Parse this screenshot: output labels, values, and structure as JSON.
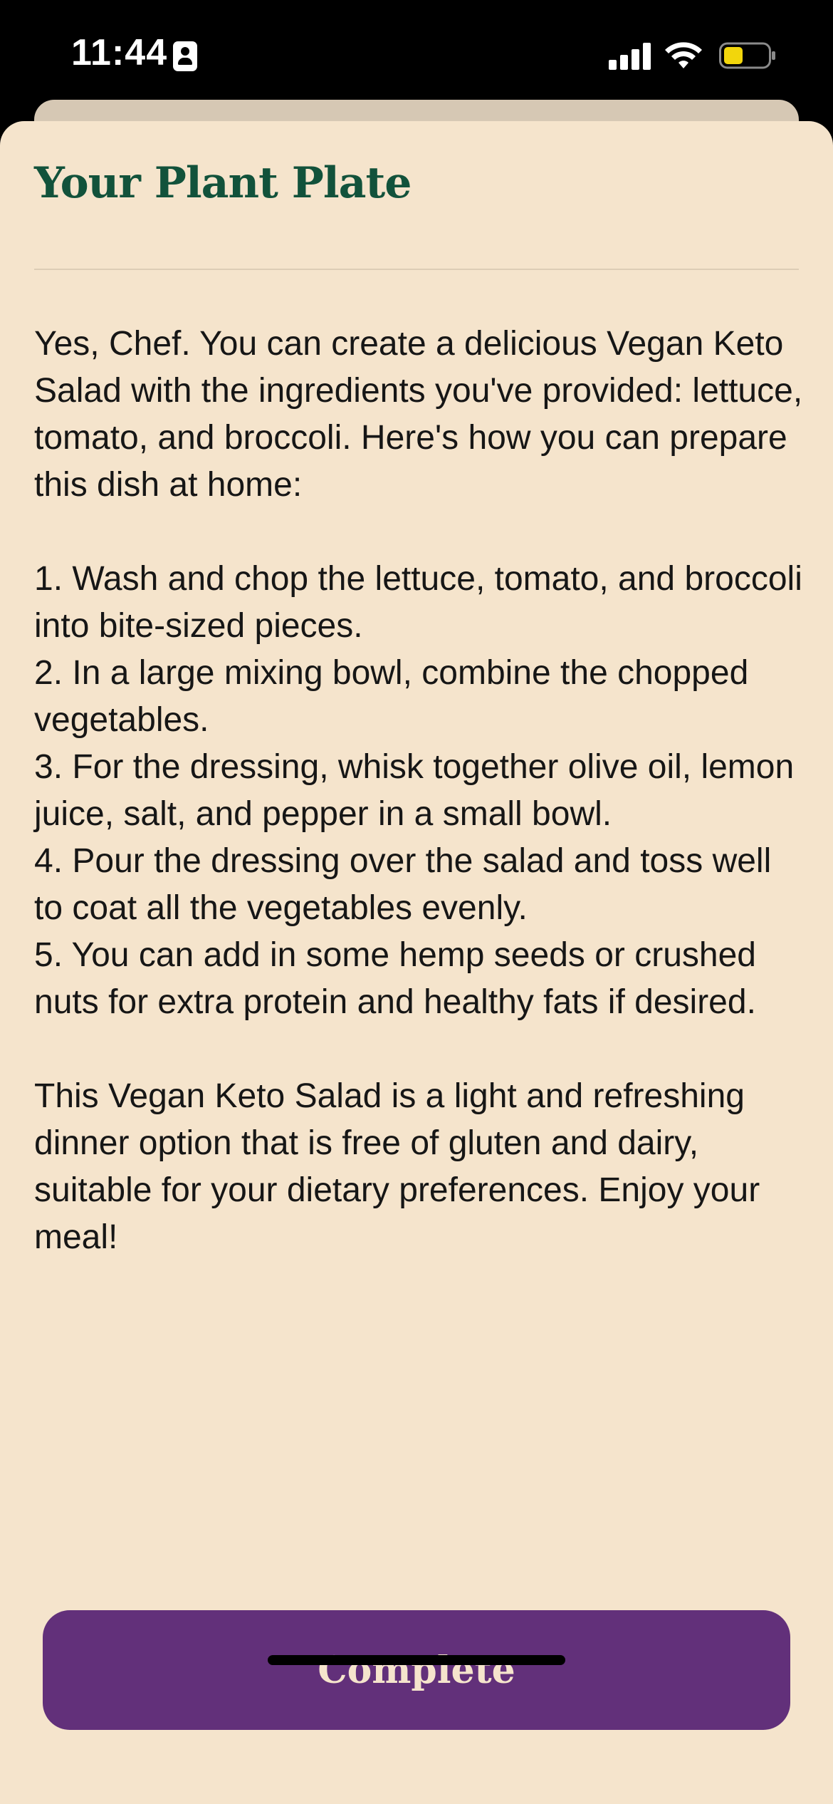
{
  "status_bar": {
    "time": "11:44",
    "battery_color": "#f2d60c"
  },
  "sheet": {
    "title": "Your Plant Plate",
    "paragraphs": [
      "Yes, Chef. You can create a delicious Vegan Keto Salad with the ingredients you've provided: lettuce, tomato, and broccoli. Here's how you can prepare this dish at home:",
      "",
      "1. Wash and chop the lettuce, tomato, and broccoli into bite-sized pieces.",
      "2. In a large mixing bowl, combine the chopped vegetables.",
      "3. For the dressing, whisk together olive oil, lemon juice, salt, and pepper in a small bowl.",
      "4. Pour the dressing over the salad and toss well to coat all the vegetables evenly.",
      "5. You can add in some hemp seeds or crushed nuts for extra protein and healthy fats if desired.",
      "",
      "This Vegan Keto Salad is a light and refreshing dinner option that is free of gluten and dairy, suitable for your dietary preferences. Enjoy your meal!"
    ],
    "complete_label": "Complete"
  },
  "colors": {
    "background": "#f5e4cc",
    "title": "#12523b",
    "button": "#62307a",
    "button_text": "#f5e4cc"
  }
}
